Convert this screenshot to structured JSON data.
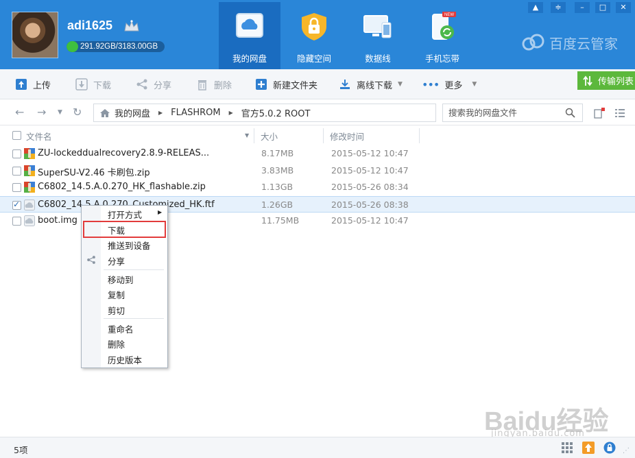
{
  "account": {
    "username": "adi1625",
    "quota_text": "291.92GB/3183.00GB",
    "quota_fraction": 0.0917
  },
  "nav": [
    {
      "label": "我的网盘",
      "icon": "cloud-drive-icon",
      "active": true
    },
    {
      "label": "隐藏空间",
      "icon": "lock-safe-icon",
      "active": false
    },
    {
      "label": "数据线",
      "icon": "monitor-phone-icon",
      "active": false
    },
    {
      "label": "手机忘带",
      "icon": "phone-sync-icon",
      "active": false,
      "badge": "NEW"
    }
  ],
  "brand": "百度云管家",
  "toolbar": {
    "upload": "上传",
    "download": "下载",
    "share": "分享",
    "delete": "删除",
    "new_folder": "新建文件夹",
    "offline_download": "离线下载",
    "more": "更多",
    "transfer_list": "传输列表"
  },
  "breadcrumb": [
    "我的网盘",
    "FLASHROM",
    "官方5.0.2 ROOT"
  ],
  "search": {
    "placeholder": "搜索我的网盘文件"
  },
  "columns": {
    "name": "文件名",
    "size": "大小",
    "modified": "修改时间"
  },
  "files": [
    {
      "name": "ZU-lockeddualrecovery2.8.9-RELEAS...",
      "size": "8.17MB",
      "modified": "2015-05-12 10:47",
      "type": "archive",
      "checked": false
    },
    {
      "name": "SuperSU-V2.46 卡刷包.zip",
      "size": "3.83MB",
      "modified": "2015-05-12 10:47",
      "type": "archive",
      "checked": false
    },
    {
      "name": "C6802_14.5.A.0.270_HK_flashable.zip",
      "size": "1.13GB",
      "modified": "2015-05-26 08:34",
      "type": "archive",
      "checked": false
    },
    {
      "name": "C6802_14.5.A.0.270_Customized_HK.ftf",
      "size": "1.26GB",
      "modified": "2015-05-26 08:38",
      "type": "file",
      "checked": true
    },
    {
      "name": "boot.img",
      "size": "11.75MB",
      "modified": "2015-05-12 10:47",
      "type": "file",
      "checked": false
    }
  ],
  "context_menu": {
    "open_with": "打开方式",
    "download": "下载",
    "push_to_device": "推送到设备",
    "share": "分享",
    "move_to": "移动到",
    "copy": "复制",
    "cut": "剪切",
    "rename": "重命名",
    "delete": "删除",
    "history": "历史版本"
  },
  "status": {
    "item_count": "5项"
  },
  "watermark": {
    "logo": "Baidu经验",
    "url": "jingyan.baidu.com"
  }
}
